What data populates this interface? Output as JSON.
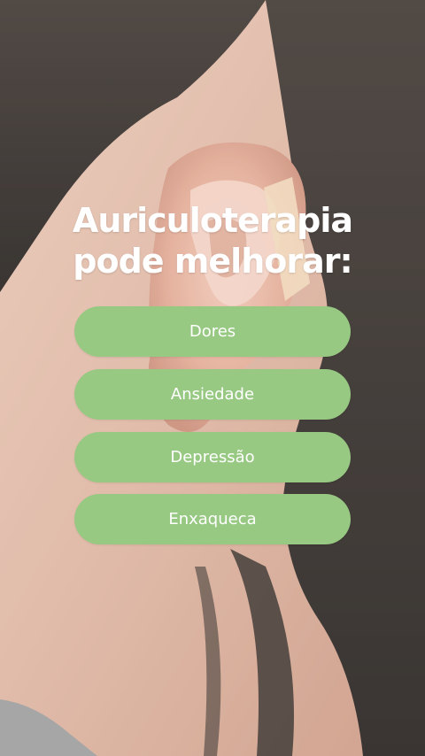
{
  "title": {
    "line1": "Auriculoterapia",
    "line2": "pode melhorar:"
  },
  "benefits": [
    {
      "label": "Dores"
    },
    {
      "label": "Ansiedade"
    },
    {
      "label": "Depressão"
    },
    {
      "label": "Enxaqueca"
    }
  ],
  "colors": {
    "pill": "#97c983",
    "text": "#ffffff"
  }
}
